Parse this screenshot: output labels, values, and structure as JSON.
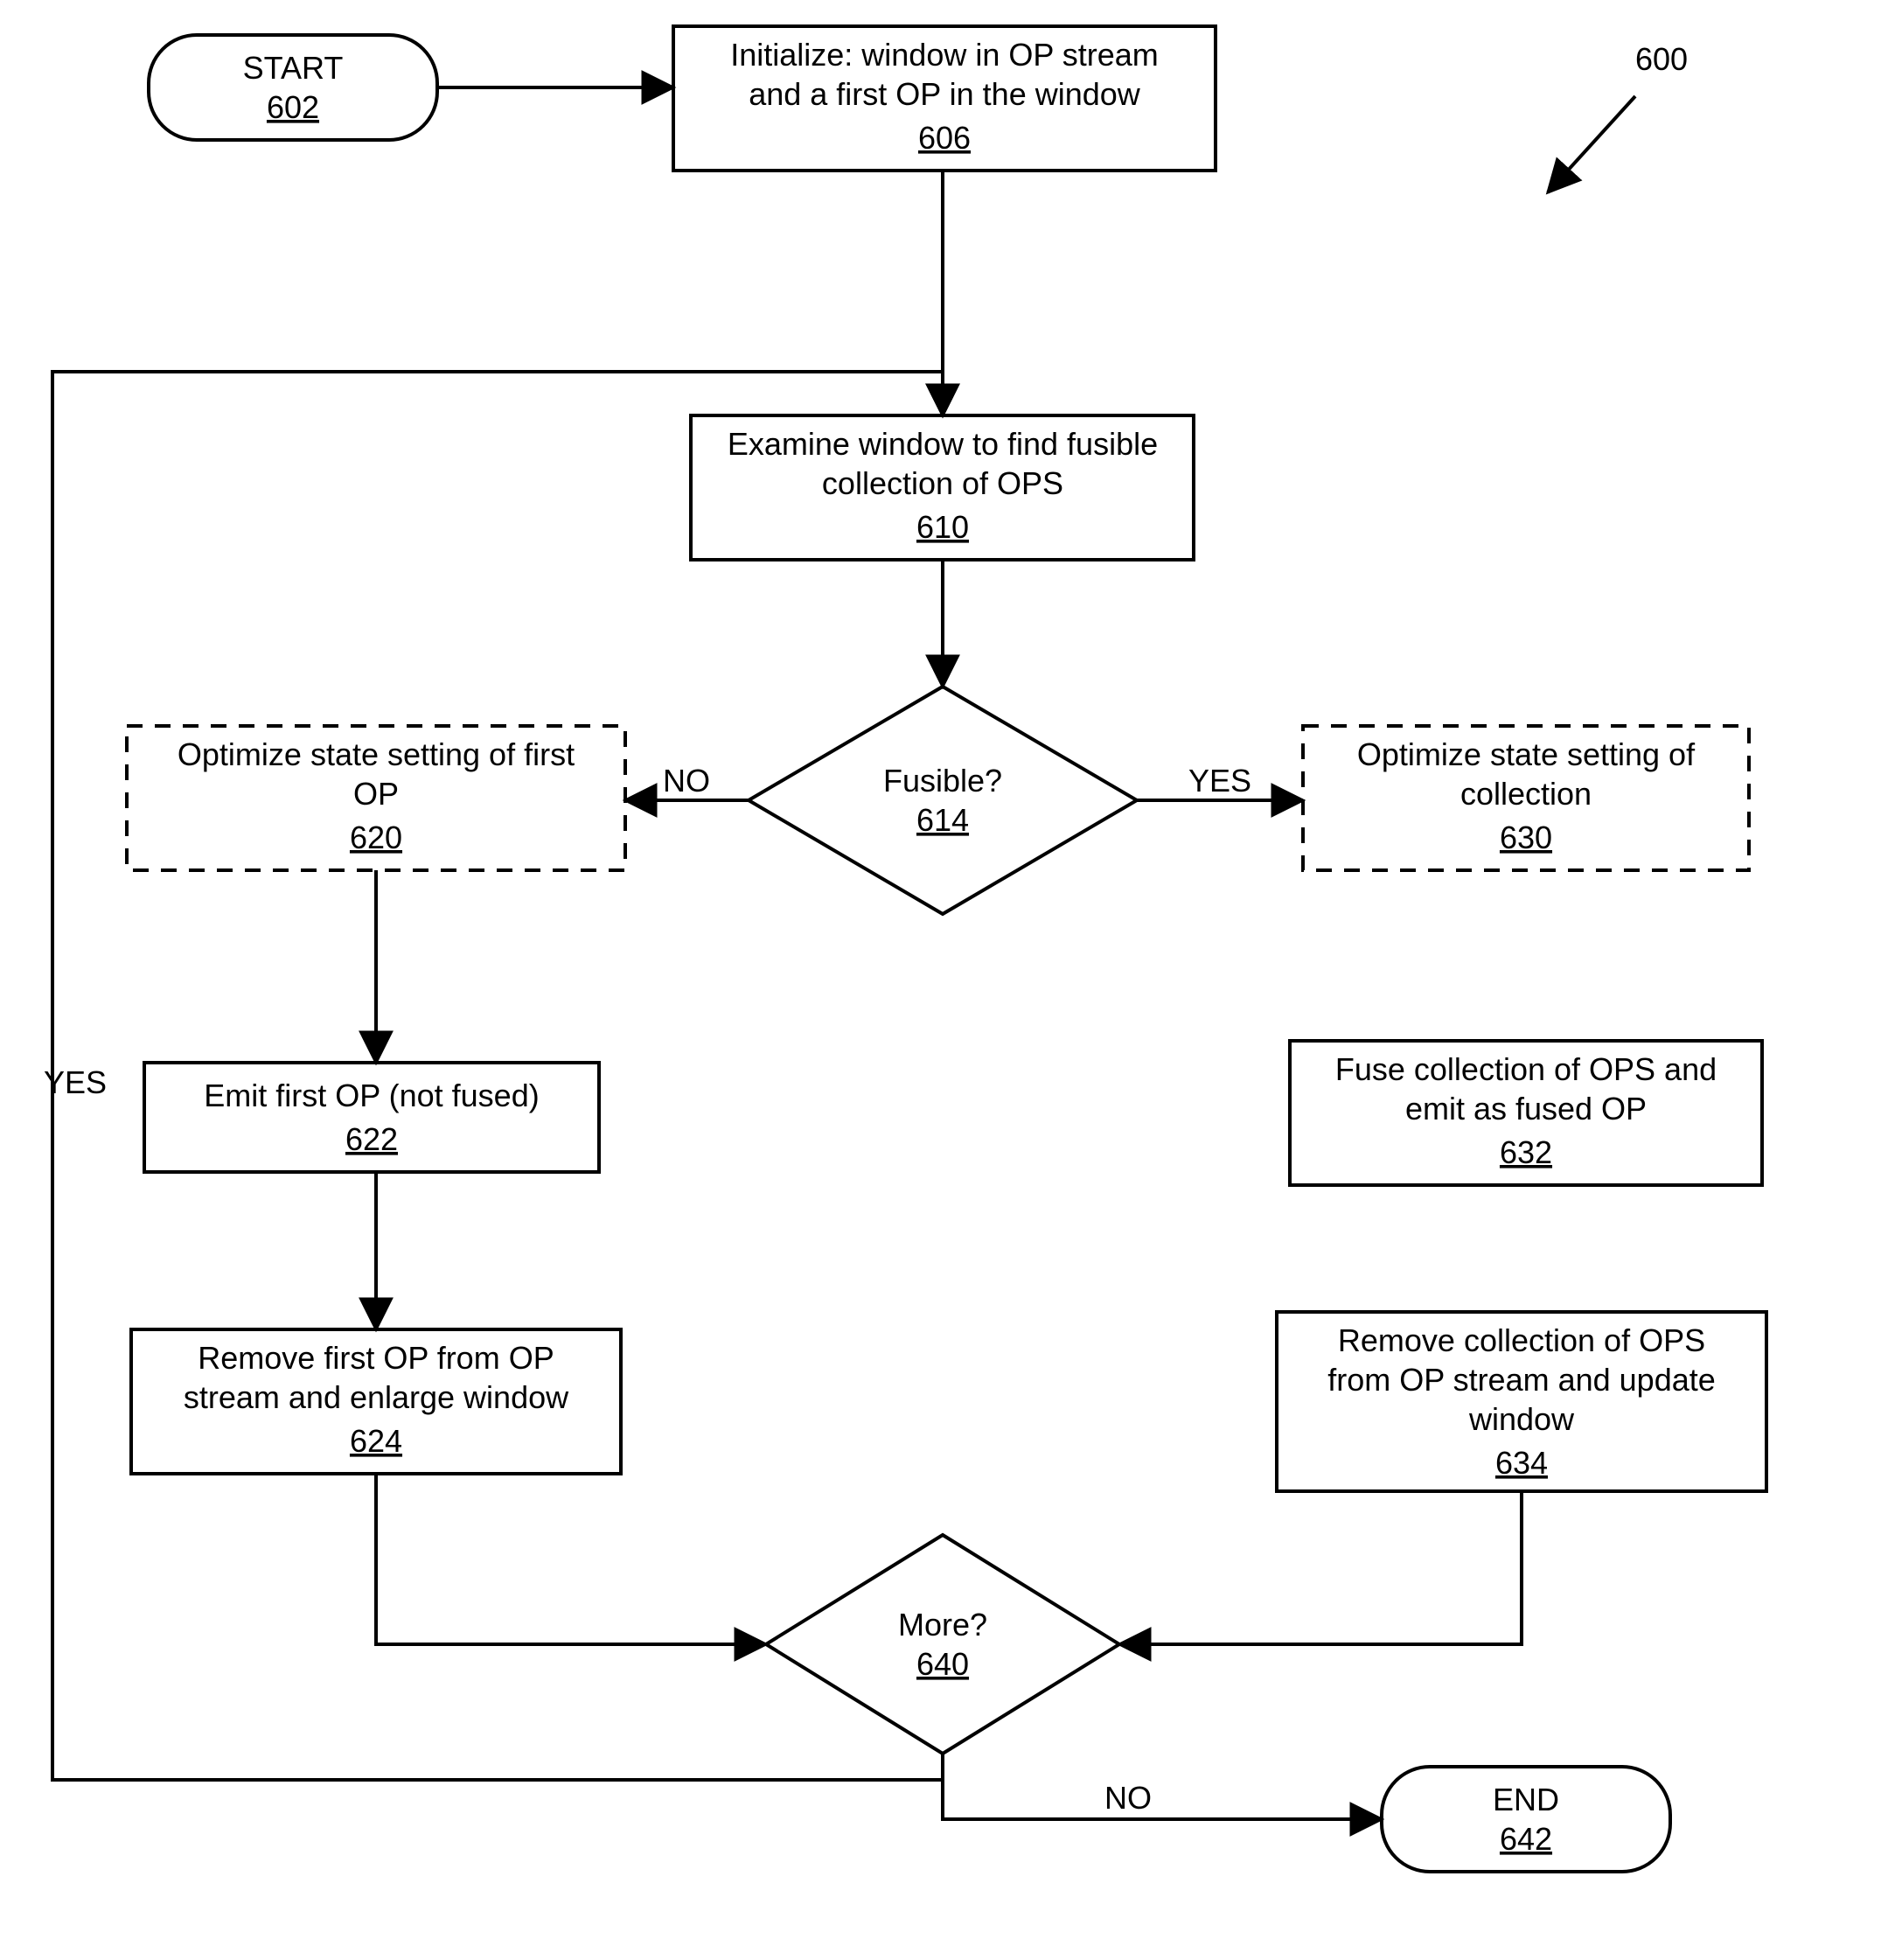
{
  "figure_ref": "600",
  "nodes": {
    "start": {
      "text": "START",
      "ref": "602"
    },
    "init": {
      "text1": "Initialize: window in OP stream",
      "text2": "and a first OP in the window",
      "ref": "606"
    },
    "examine": {
      "text1": "Examine window to find fusible",
      "text2": "collection of OPS",
      "ref": "610"
    },
    "fusible": {
      "text": "Fusible?",
      "ref": "614"
    },
    "opt_first": {
      "text1": "Optimize state setting of first",
      "text2": "OP",
      "ref": "620"
    },
    "emit_first": {
      "text": "Emit first OP (not fused)",
      "ref": "622"
    },
    "remove_first": {
      "text1": "Remove first OP from OP",
      "text2": "stream and enlarge window",
      "ref": "624"
    },
    "opt_coll": {
      "text1": "Optimize state setting of",
      "text2": "collection",
      "ref": "630"
    },
    "fuse_coll": {
      "text1": "Fuse collection of OPS and",
      "text2": "emit as fused OP",
      "ref": "632"
    },
    "remove_coll": {
      "text1": "Remove collection of OPS",
      "text2": "from OP stream and update",
      "text3": "window",
      "ref": "634"
    },
    "more": {
      "text": "More?",
      "ref": "640"
    },
    "end": {
      "text": "END",
      "ref": "642"
    }
  },
  "edges": {
    "no": "NO",
    "yes": "YES"
  }
}
